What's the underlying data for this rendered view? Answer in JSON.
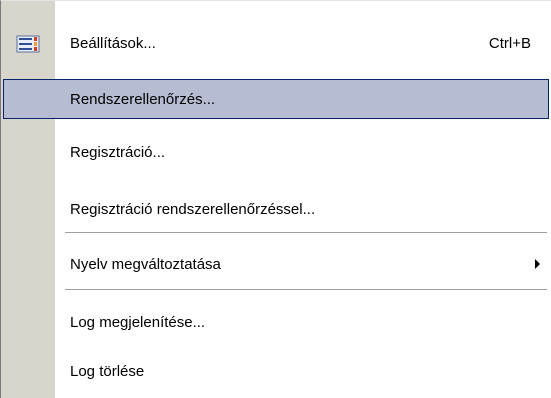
{
  "menu": {
    "items": [
      {
        "label": "Beállítások...",
        "shortcut": "Ctrl+B",
        "icon": "settings-icon"
      },
      {
        "label": "Rendszerellenőrzés..."
      },
      {
        "label": "Regisztráció..."
      },
      {
        "label": "Regisztráció rendszerellenőrzéssel..."
      },
      {
        "label": "Nyelv megváltoztatása",
        "submenu": true
      },
      {
        "label": "Log megjelenítése..."
      },
      {
        "label": "Log törlése"
      }
    ],
    "selected_index": 1,
    "colors": {
      "icon_column": "#d8d5cc",
      "highlight_fill": "#b6bdd2",
      "highlight_border": "#0a246a"
    }
  }
}
